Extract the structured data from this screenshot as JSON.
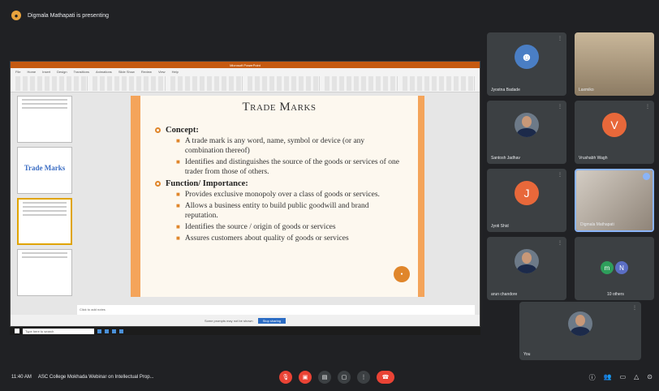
{
  "presenter": {
    "text": "Digmala Mathapati is presenting"
  },
  "ppt": {
    "title": "Microsoft PowerPoint",
    "tabs": [
      "File",
      "Home",
      "Insert",
      "Design",
      "Transitions",
      "Animations",
      "Slide Show",
      "Review",
      "View",
      "Help"
    ],
    "thumb_title": "Trade Marks",
    "slide": {
      "title": "Trade Marks",
      "h1": "Concept:",
      "c1": "A trade mark is any word, name, symbol or device (or any combination thereof)",
      "c2": "Identifies and distinguishes the source of the goods or services of one trader from those of others.",
      "h2": "Function/ Importance:",
      "f1": "Provides exclusive monopoly over a class of goods or services.",
      "f2": "Allows a business entity to build public goodwill and brand reputation.",
      "f3": "Identifies the source / origin of goods or services",
      "f4": "Assures customers about quality of goods or services"
    },
    "notes": "Click to add notes",
    "status_text": "Some prompts may not be shown",
    "status_btn": "Stop sharing",
    "taskbar_search": "Type here to search"
  },
  "participants": [
    {
      "name": "Jyostna Badade",
      "type": "avatar-circle",
      "color": "#4a7ec4"
    },
    {
      "name": "Laxmiko",
      "type": "video"
    },
    {
      "name": "Santosh Jadhav",
      "type": "photo"
    },
    {
      "name": "Vrushabh Wagh",
      "initial": "V",
      "color": "#e8683a"
    },
    {
      "name": "Jyoti Shid",
      "initial": "J",
      "color": "#e8683a"
    },
    {
      "name": "Digmala Mathapati",
      "type": "video"
    },
    {
      "name": "arun chandore",
      "type": "photo"
    },
    {
      "name": "10 others",
      "initials": [
        "m",
        "N"
      ]
    },
    {
      "name": "You",
      "type": "photo"
    }
  ],
  "meeting": {
    "time": "11:40 AM",
    "title": "ASC College Mokhada Webinar on Intellectual Prop..."
  }
}
